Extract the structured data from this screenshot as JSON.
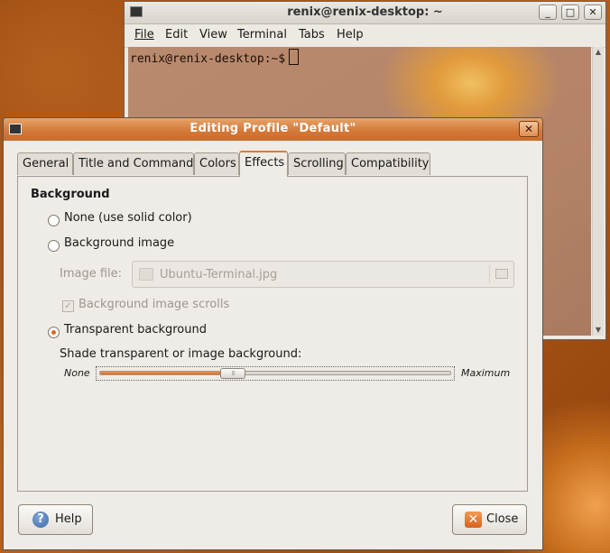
{
  "terminal": {
    "title": "renix@renix-desktop: ~",
    "controls": {
      "minimize": "_",
      "maximize": "□",
      "close": "✕"
    },
    "menus": [
      "File",
      "Edit",
      "View",
      "Terminal",
      "Tabs",
      "Help"
    ],
    "prompt": "renix@renix-desktop:~$"
  },
  "dialog": {
    "title": "Editing Profile \"Default\"",
    "close_glyph": "✕",
    "tabs": [
      "General",
      "Title and Command",
      "Colors",
      "Effects",
      "Scrolling",
      "Compatibility"
    ],
    "active_tab": "Effects",
    "background": {
      "section_title": "Background",
      "none_label": "None (use solid color)",
      "image_label": "Background image",
      "image_file_label": "Image file:",
      "image_file_value": "Ubuntu-Terminal.jpg",
      "scrolls_label": "Background image scrolls",
      "transparent_label": "Transparent background",
      "selected": "transparent"
    },
    "shade": {
      "label": "Shade transparent or image background:",
      "min_label": "None",
      "max_label": "Maximum",
      "value_percent": 38
    },
    "buttons": {
      "help": "Help",
      "close": "Close"
    }
  },
  "colors": {
    "accent": "#e07a2e",
    "titlebar_active": "#d37a3a"
  }
}
